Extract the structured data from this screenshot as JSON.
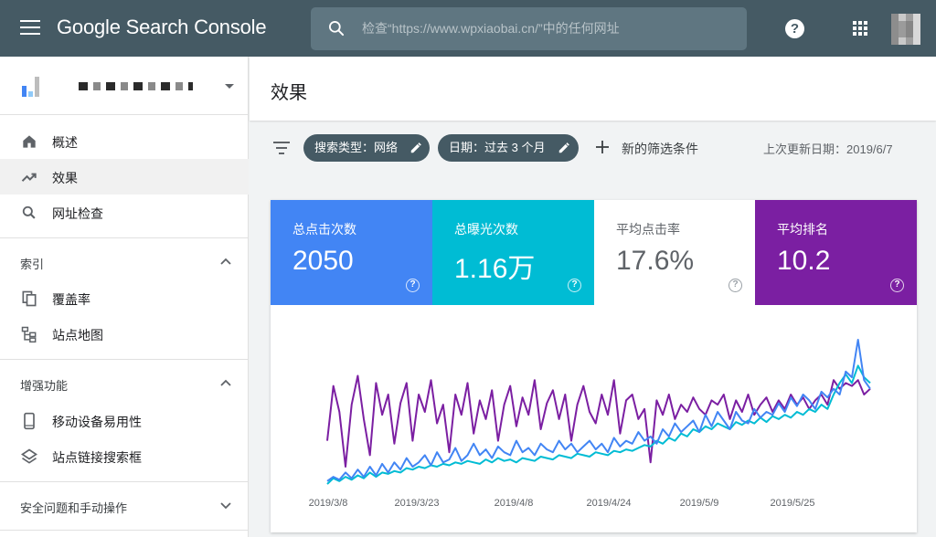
{
  "app": {
    "title": "Google Search Console"
  },
  "search": {
    "placeholder": "检查“https://www.wpxiaobai.cn/”中的任何网址"
  },
  "header": {
    "help_label": "?"
  },
  "page": {
    "title": "效果"
  },
  "sidebar": {
    "items": [
      {
        "label": "概述",
        "icon": "home-icon"
      },
      {
        "label": "效果",
        "icon": "trending-up-icon",
        "active": true
      },
      {
        "label": "网址检查",
        "icon": "search-icon"
      }
    ],
    "sections": [
      {
        "title": "索引",
        "expanded": true,
        "items": [
          {
            "label": "覆盖率",
            "icon": "copy-icon"
          },
          {
            "label": "站点地图",
            "icon": "sitemap-icon"
          }
        ]
      },
      {
        "title": "增强功能",
        "expanded": true,
        "items": [
          {
            "label": "移动设备易用性",
            "icon": "phone-icon"
          },
          {
            "label": "站点链接搜索框",
            "icon": "layers-icon"
          }
        ]
      },
      {
        "title": "安全问题和手动操作",
        "expanded": false,
        "items": []
      }
    ]
  },
  "filters": {
    "chips": [
      {
        "label": "搜索类型：网络"
      },
      {
        "label": "日期：过去 3 个月"
      }
    ],
    "new_filter_label": "新的筛选条件",
    "last_updated": "上次更新日期：2019/6/7"
  },
  "metrics": [
    {
      "label": "总点击次数",
      "value": "2050",
      "color": "#4285f4",
      "selected": true
    },
    {
      "label": "总曝光次数",
      "value": "1.16万",
      "color": "#00bcd4",
      "selected": true
    },
    {
      "label": "平均点击率",
      "value": "17.6%",
      "color": "#ffffff",
      "selected": false
    },
    {
      "label": "平均排名",
      "value": "10.2",
      "color": "#7b1fa2",
      "selected": true
    }
  ],
  "chart_data": {
    "type": "line",
    "x_ticks": [
      "2019/3/8",
      "2019/3/23",
      "2019/4/8",
      "2019/4/24",
      "2019/5/9",
      "2019/5/25"
    ],
    "y_normalized": true,
    "series": [
      {
        "name": "总点击次数",
        "color": "#4285f4",
        "values": [
          0.02,
          0.05,
          0.03,
          0.08,
          0.04,
          0.1,
          0.05,
          0.12,
          0.06,
          0.14,
          0.08,
          0.15,
          0.1,
          0.18,
          0.12,
          0.15,
          0.2,
          0.13,
          0.22,
          0.15,
          0.17,
          0.25,
          0.16,
          0.2,
          0.28,
          0.2,
          0.24,
          0.18,
          0.26,
          0.22,
          0.2,
          0.3,
          0.22,
          0.25,
          0.2,
          0.28,
          0.24,
          0.22,
          0.3,
          0.24,
          0.28,
          0.22,
          0.26,
          0.3,
          0.24,
          0.28,
          0.22,
          0.32,
          0.26,
          0.3,
          0.28,
          0.36,
          0.3,
          0.33,
          0.28,
          0.38,
          0.33,
          0.42,
          0.36,
          0.4,
          0.44,
          0.36,
          0.48,
          0.4,
          0.5,
          0.44,
          0.38,
          0.5,
          0.44,
          0.42,
          0.52,
          0.46,
          0.5,
          0.48,
          0.56,
          0.5,
          0.6,
          0.54,
          0.62,
          0.58,
          0.52,
          0.64,
          0.6,
          0.66,
          0.62,
          0.78,
          0.74,
          1.0,
          0.72,
          0.66
        ]
      },
      {
        "name": "总曝光次数",
        "color": "#00bcd4",
        "values": [
          0.0,
          0.04,
          0.02,
          0.05,
          0.03,
          0.06,
          0.04,
          0.08,
          0.05,
          0.08,
          0.07,
          0.09,
          0.08,
          0.11,
          0.1,
          0.12,
          0.11,
          0.13,
          0.12,
          0.14,
          0.13,
          0.15,
          0.14,
          0.16,
          0.15,
          0.14,
          0.17,
          0.15,
          0.18,
          0.16,
          0.17,
          0.15,
          0.18,
          0.17,
          0.16,
          0.19,
          0.18,
          0.17,
          0.2,
          0.19,
          0.18,
          0.21,
          0.2,
          0.19,
          0.22,
          0.21,
          0.2,
          0.23,
          0.22,
          0.24,
          0.23,
          0.25,
          0.27,
          0.26,
          0.3,
          0.28,
          0.32,
          0.3,
          0.35,
          0.33,
          0.38,
          0.36,
          0.4,
          0.38,
          0.42,
          0.4,
          0.38,
          0.43,
          0.41,
          0.44,
          0.42,
          0.46,
          0.43,
          0.47,
          0.45,
          0.48,
          0.46,
          0.5,
          0.48,
          0.52,
          0.5,
          0.55,
          0.52,
          0.62,
          0.7,
          0.76,
          0.7,
          0.82,
          0.74,
          0.7
        ]
      },
      {
        "name": "平均排名",
        "color": "#7b1fa2",
        "values": [
          0.3,
          0.68,
          0.5,
          0.12,
          0.55,
          0.75,
          0.45,
          0.2,
          0.7,
          0.48,
          0.62,
          0.28,
          0.56,
          0.7,
          0.3,
          0.62,
          0.5,
          0.72,
          0.42,
          0.55,
          0.22,
          0.62,
          0.48,
          0.7,
          0.35,
          0.58,
          0.45,
          0.65,
          0.3,
          0.55,
          0.68,
          0.4,
          0.6,
          0.48,
          0.72,
          0.38,
          0.56,
          0.65,
          0.45,
          0.62,
          0.3,
          0.55,
          0.68,
          0.5,
          0.42,
          0.62,
          0.48,
          0.72,
          0.35,
          0.58,
          0.62,
          0.45,
          0.52,
          0.15,
          0.58,
          0.48,
          0.62,
          0.45,
          0.55,
          0.5,
          0.6,
          0.52,
          0.48,
          0.58,
          0.55,
          0.62,
          0.45,
          0.58,
          0.5,
          0.62,
          0.48,
          0.55,
          0.6,
          0.5,
          0.58,
          0.52,
          0.62,
          0.55,
          0.6,
          0.52,
          0.58,
          0.62,
          0.55,
          0.72,
          0.66,
          0.7,
          0.68,
          0.72,
          0.62,
          0.66
        ]
      }
    ]
  }
}
